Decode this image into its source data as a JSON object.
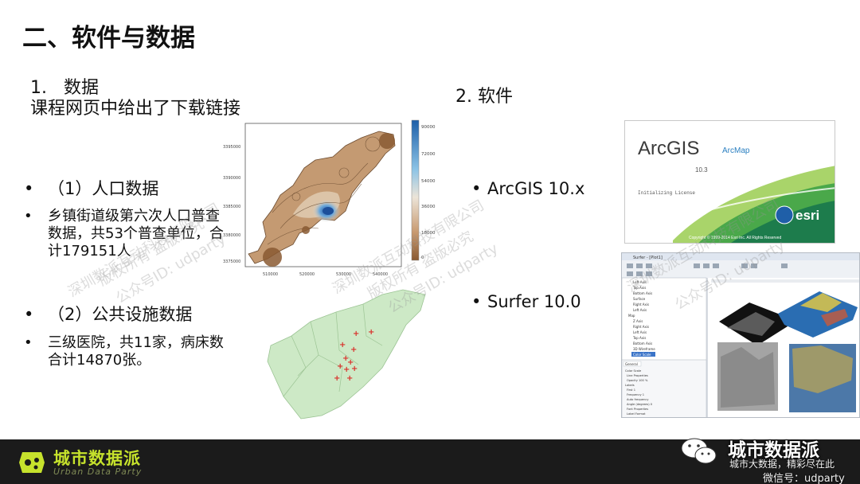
{
  "slide": {
    "title": "二、软件与数据"
  },
  "data_section": {
    "heading": "1.   数据",
    "subtitle": "课程网页中给出了下载链接",
    "bullets": [
      {
        "marker": "•",
        "text": "（1）人口数据"
      },
      {
        "marker": "•",
        "text": "乡镇街道级第六次人口普查数据，共53个普查单位，合计179151人"
      },
      {
        "marker": "•",
        "text": "（2）公共设施数据"
      },
      {
        "marker": "•",
        "text": "三级医院，共11家，病床数合计14870张。"
      }
    ]
  },
  "software_section": {
    "heading": "2. 软件",
    "bullets": [
      {
        "marker": "•",
        "text": "ArcGIS 10.x"
      },
      {
        "marker": "•",
        "text": "Surfer 10.0"
      }
    ]
  },
  "population_map": {
    "y_ticks": [
      "3395000",
      "3390000",
      "3385000",
      "3380000",
      "3375000"
    ],
    "x_ticks": [
      "510000",
      "520000",
      "530000",
      "540000"
    ],
    "legend_ticks": [
      "90000",
      "72000",
      "54000",
      "36000",
      "18000",
      "0"
    ]
  },
  "arcgis_splash": {
    "brand": "ArcGIS",
    "product": "ArcMap",
    "version": "10.3",
    "status": "Initializing License",
    "vendor": "esri",
    "copyright": "Copyright © 1999-2014 Esri Inc. All Rights Reserved"
  },
  "surfer_window": {
    "title": "Surfer - [Plot1]",
    "tree_items": [
      "Left Axis",
      "Top Axis",
      "Bottom Axis",
      "Surface",
      "Right Axis",
      "Left Axis",
      "Map",
      "Z Axis",
      "Right Axis",
      "Left Axis",
      "Top Axis",
      "Bottom Axis",
      "3D Wireframe",
      "Color Scale"
    ],
    "panel_tab": "General",
    "props": [
      "Color Scale",
      "Line Properties",
      "Opacity  100 %",
      "Labels",
      "First   1",
      "Frequency  1",
      "Auto frequency",
      "Angle (degrees)  0",
      "Font Properties",
      "Label Format"
    ]
  },
  "watermarks": [
    "深圳数派互动科技有限公司",
    "版权所有  盗版必究",
    "公众号ID: udparty"
  ],
  "footer": {
    "brand": "城市数据派",
    "tagline": "Urban Data Party",
    "wechat_name": "城市数据派",
    "wechat_slogan": "城市大数据，精彩尽在此",
    "wechat_id": "微信号：udparty"
  }
}
